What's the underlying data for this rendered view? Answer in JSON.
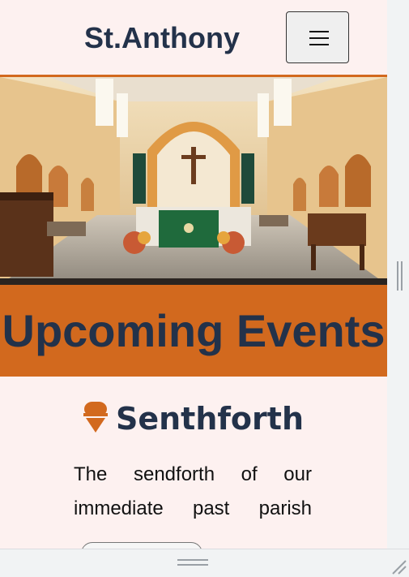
{
  "navbar": {
    "brand": "St.Anthony",
    "menu_icon": "hamburger-icon"
  },
  "hero": {
    "image_subject": "church-interior-altar"
  },
  "events": {
    "title": "Upcoming Events"
  },
  "event": {
    "icon": "ice-cream-icon",
    "title": "Senthforth",
    "description": "The sendforth of our immediate past parish"
  },
  "colors": {
    "accent": "#d2691e",
    "heading": "#23324a",
    "background": "#fdf1f0"
  }
}
